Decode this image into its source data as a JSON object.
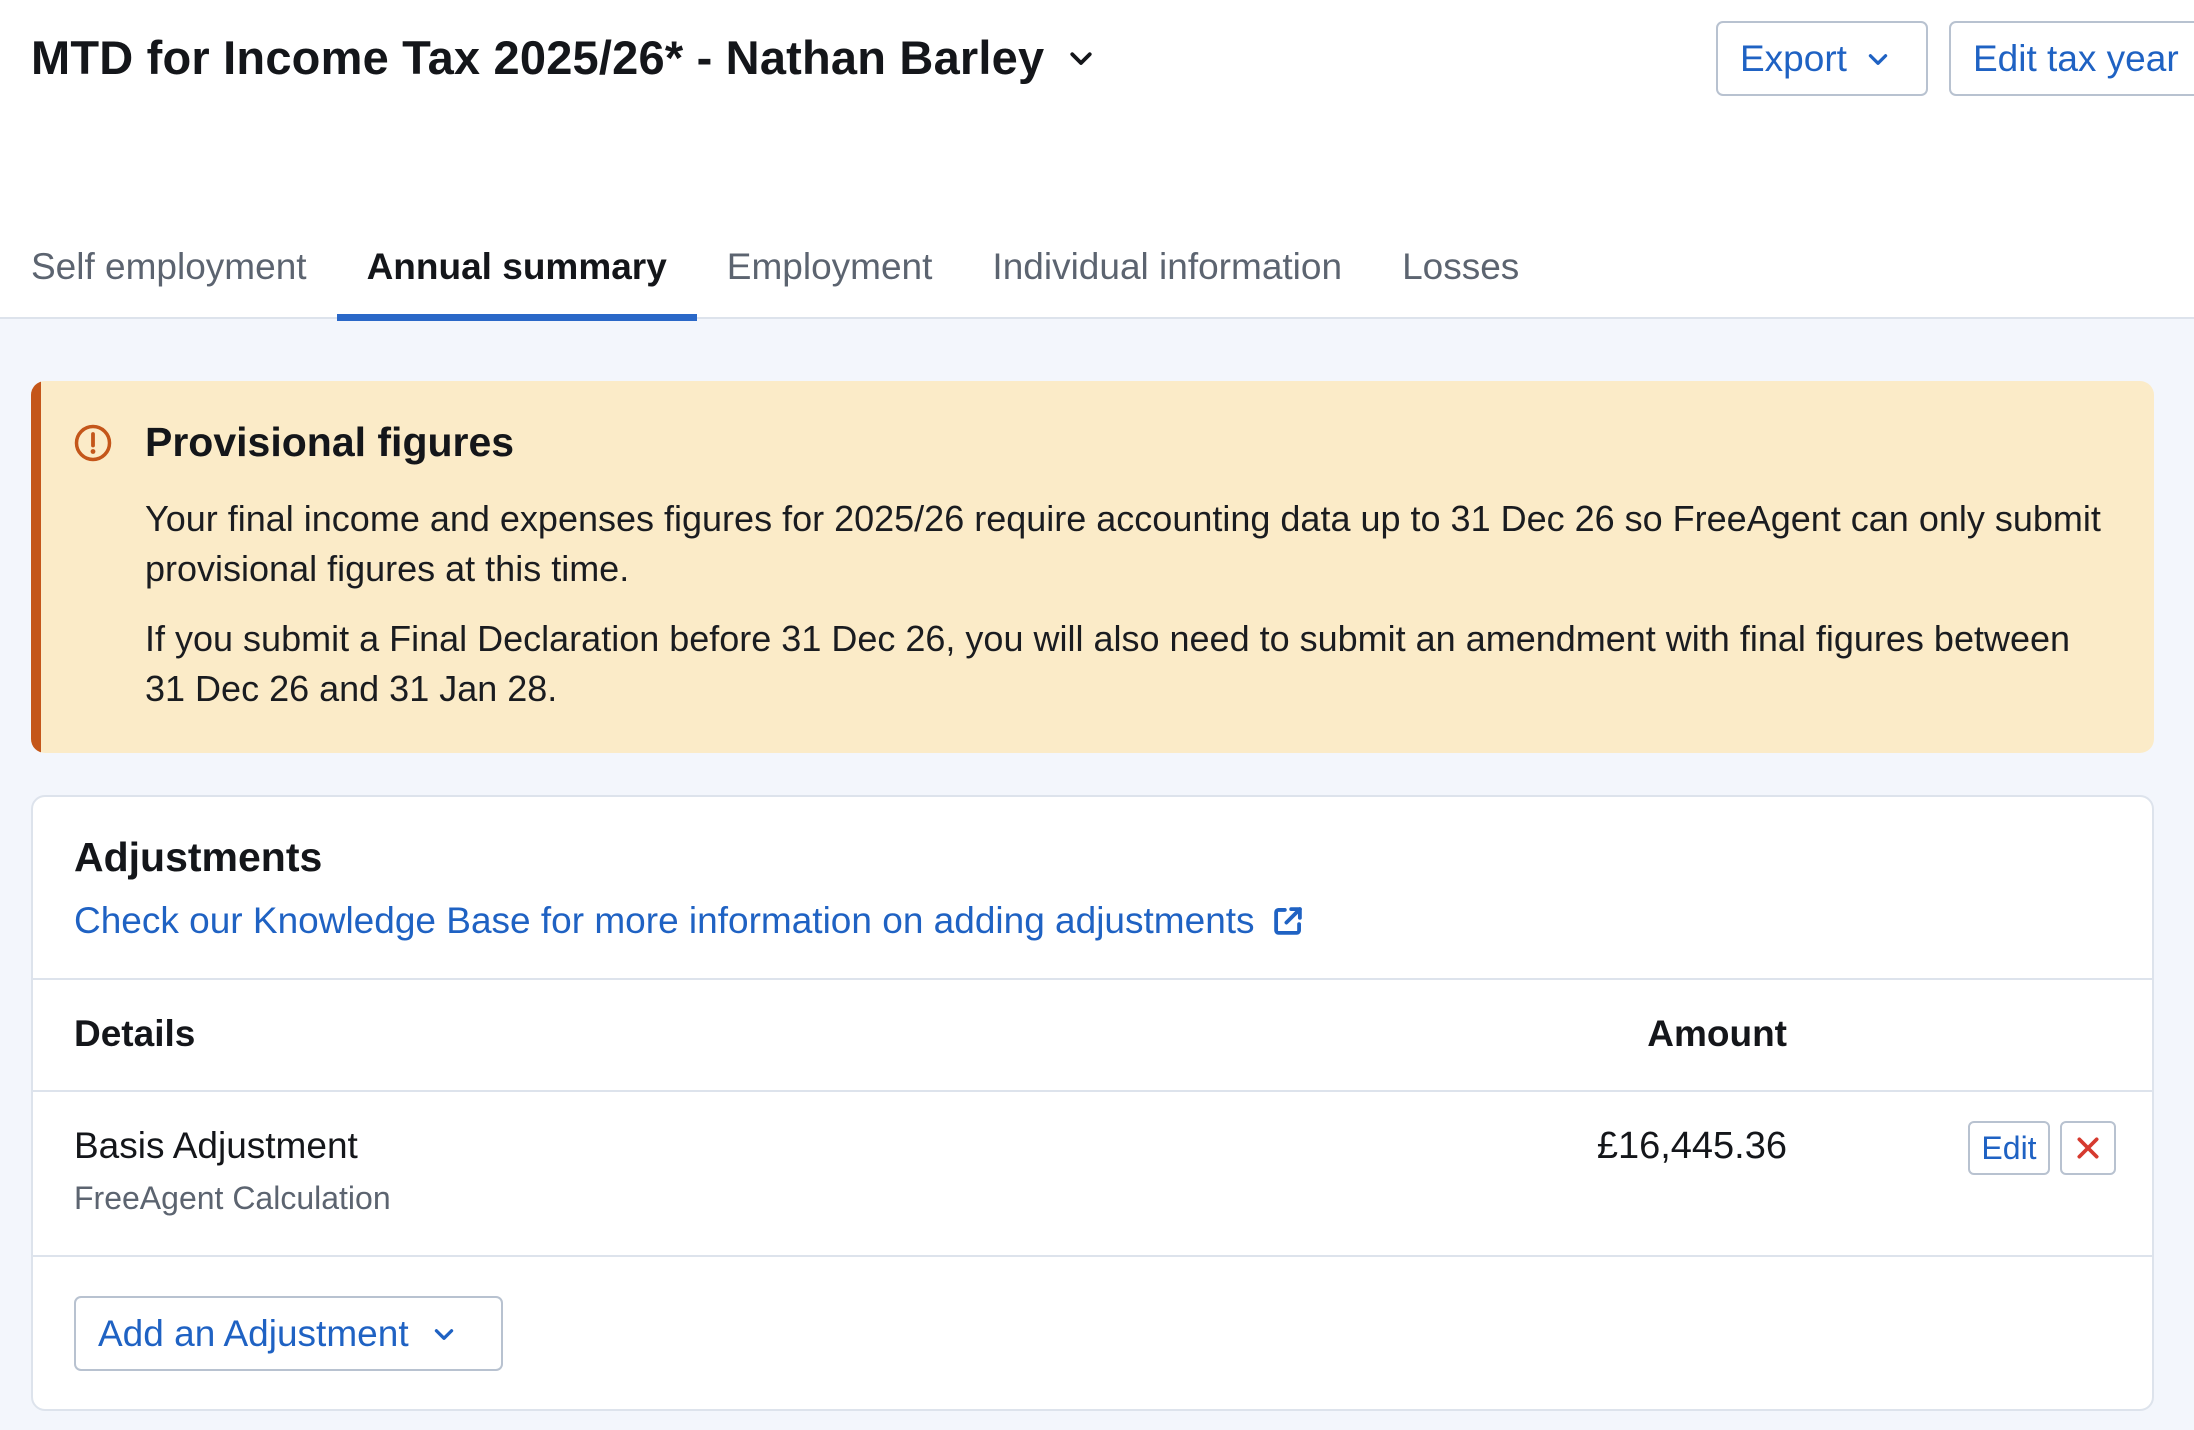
{
  "header": {
    "title": "MTD for Income Tax 2025/26* - Nathan Barley",
    "export_label": "Export",
    "edit_tax_year_label": "Edit tax year"
  },
  "tabs": [
    {
      "label": "Self employment",
      "active": false
    },
    {
      "label": "Annual summary",
      "active": true
    },
    {
      "label": "Employment",
      "active": false
    },
    {
      "label": "Individual information",
      "active": false
    },
    {
      "label": "Losses",
      "active": false
    }
  ],
  "banner": {
    "title": "Provisional figures",
    "paragraph_1": "Your final income and expenses figures for 2025/26 require accounting data up to 31 Dec 26 so FreeAgent can only submit provisional figures at this time.",
    "paragraph_2": "If you submit a Final Declaration before 31 Dec 26, you will also need to submit an amendment with final figures between 31 Dec 26 and 31 Jan 28.",
    "icon": "alert-circle-icon",
    "accent_color": "#c4561a",
    "background_color": "#fbebc8"
  },
  "adjustments": {
    "title": "Adjustments",
    "kb_link": "Check our Knowledge Base for more information on adding adjustments",
    "columns": {
      "details": "Details",
      "amount": "Amount"
    },
    "rows": [
      {
        "detail": "Basis Adjustment",
        "source": "FreeAgent Calculation",
        "amount": "£16,445.36",
        "edit_label": "Edit"
      }
    ],
    "add_label": "Add an Adjustment"
  },
  "colors": {
    "link": "#1f62c3",
    "tab_active_underline": "#2a68c8",
    "delete": "#d63a2f"
  }
}
